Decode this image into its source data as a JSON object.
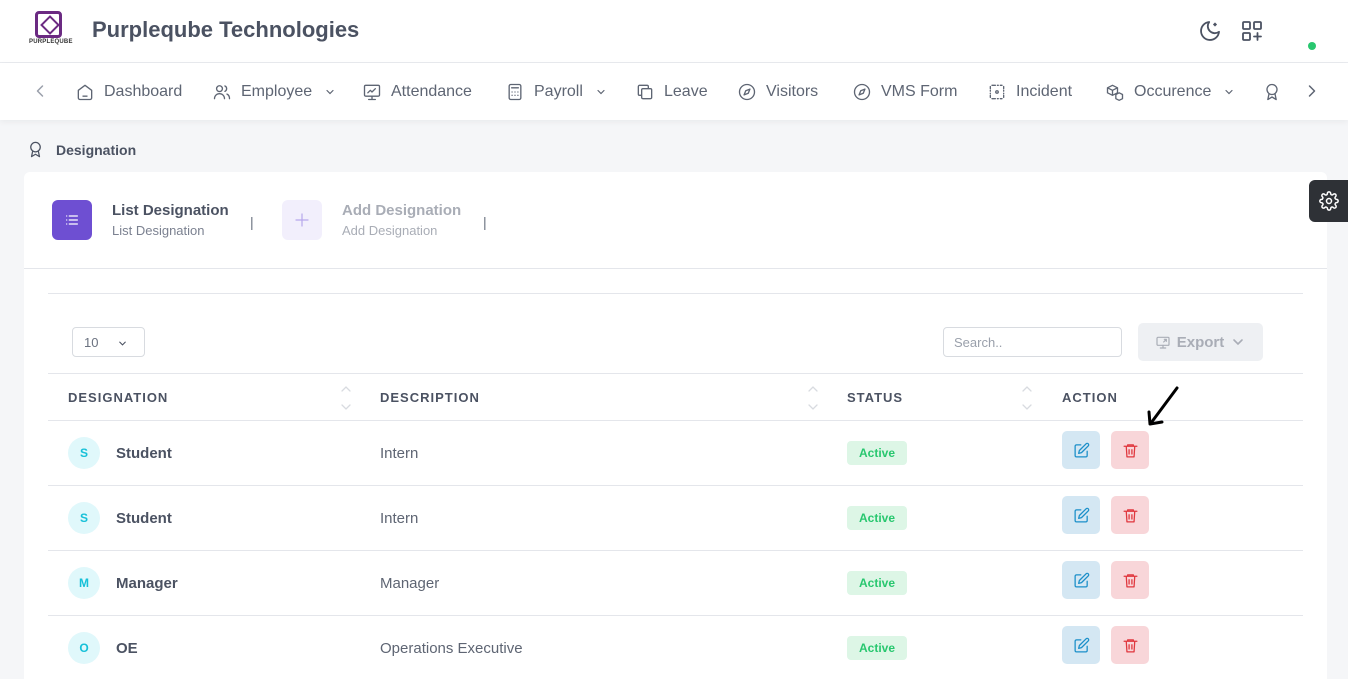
{
  "app": {
    "title": "Purpleqube Technologies",
    "logo_text": "PURPLEQUBE",
    "logo_icon": "purpleqube-logo"
  },
  "header_icons": [
    "moon-icon",
    "apps-grid-add-icon"
  ],
  "nav": {
    "items": [
      {
        "label": "Dashboard",
        "icon": "home-icon",
        "dropdown": false
      },
      {
        "label": "Employee",
        "icon": "users-icon",
        "dropdown": true
      },
      {
        "label": "Attendance",
        "icon": "monitor-chart-icon",
        "dropdown": false
      },
      {
        "label": "Payroll",
        "icon": "calculator-icon",
        "dropdown": true
      },
      {
        "label": "Leave",
        "icon": "copy-icon",
        "dropdown": false
      },
      {
        "label": "Visitors",
        "icon": "compass-icon",
        "dropdown": false
      },
      {
        "label": "VMS Form",
        "icon": "compass-icon",
        "dropdown": false
      },
      {
        "label": "Incident",
        "icon": "focus-icon",
        "dropdown": false
      },
      {
        "label": "Occurence",
        "icon": "boxes-icon",
        "dropdown": true
      }
    ]
  },
  "breadcrumb": {
    "label": "Designation",
    "icon": "award-icon"
  },
  "tabs": [
    {
      "title": "List Designation",
      "subtitle": "List Designation",
      "icon": "list-icon",
      "active": true
    },
    {
      "title": "Add Designation",
      "subtitle": "Add Designation",
      "icon": "plus-icon",
      "active": false
    }
  ],
  "tab_separator": "|",
  "table": {
    "page_length": "10",
    "search_placeholder": "Search..",
    "export_label": "Export",
    "columns": [
      "DESIGNATION",
      "DESCRIPTION",
      "STATUS",
      "ACTION"
    ],
    "rows": [
      {
        "initial": "S",
        "name": "Student",
        "description": "Intern",
        "status": "Active"
      },
      {
        "initial": "S",
        "name": "Student",
        "description": "Intern",
        "status": "Active"
      },
      {
        "initial": "M",
        "name": "Manager",
        "description": "Manager",
        "status": "Active"
      },
      {
        "initial": "O",
        "name": "OE",
        "description": "Operations Executive",
        "status": "Active"
      }
    ]
  },
  "colors": {
    "accent": "#6e4fd2",
    "active_badge": "#28c76f",
    "edit_button": "#d4e7f3",
    "delete_button": "#f8d6d9"
  }
}
